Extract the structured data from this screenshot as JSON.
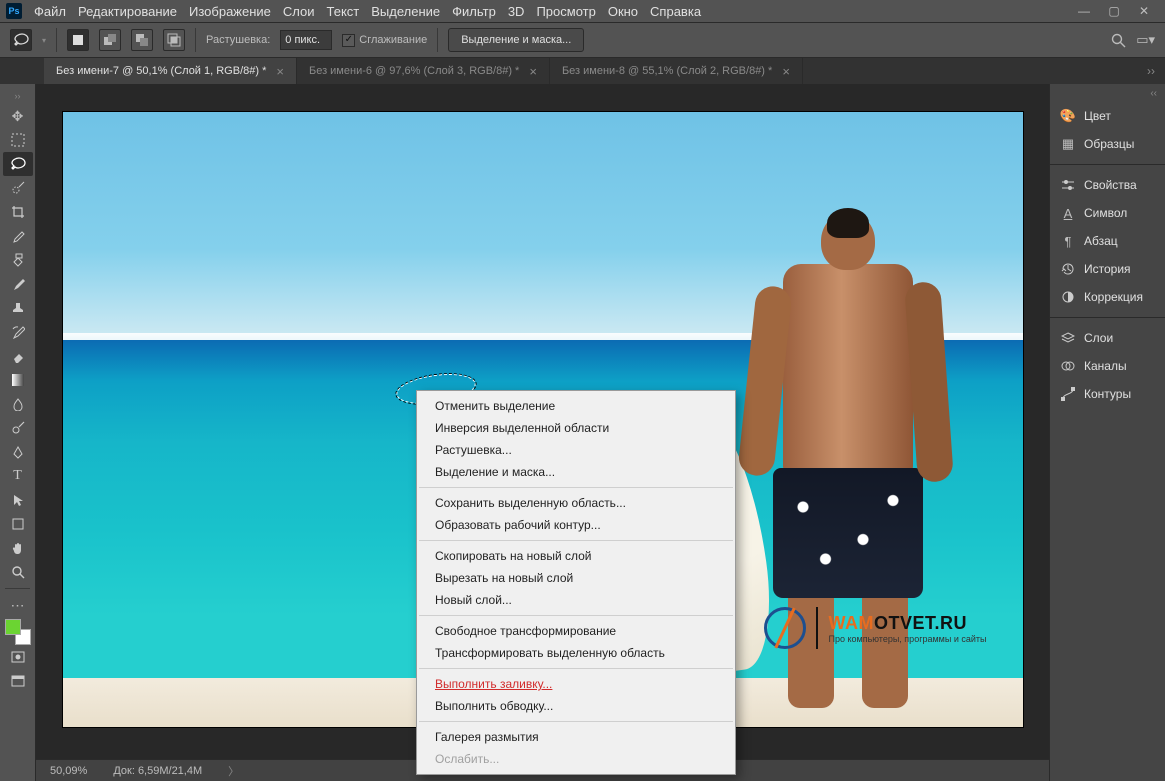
{
  "menubar": {
    "items": [
      "Файл",
      "Редактирование",
      "Изображение",
      "Слои",
      "Текст",
      "Выделение",
      "Фильтр",
      "3D",
      "Просмотр",
      "Окно",
      "Справка"
    ]
  },
  "options": {
    "feather_label": "Растушевка:",
    "feather_value": "0 пикс.",
    "antialias_label": "Сглаживание",
    "select_mask_btn": "Выделение и маска..."
  },
  "tabs": [
    {
      "label": "Без имени-7 @ 50,1% (Слой 1, RGB/8#) *",
      "active": true
    },
    {
      "label": "Без имени-6 @ 97,6% (Слой 3, RGB/8#) *",
      "active": false
    },
    {
      "label": "Без имени-8 @ 55,1% (Слой 2, RGB/8#) *",
      "active": false
    }
  ],
  "panels": {
    "group1": [
      {
        "icon": "palette-icon",
        "label": "Цвет"
      },
      {
        "icon": "swatch-icon",
        "label": "Образцы"
      }
    ],
    "group2": [
      {
        "icon": "sliders-icon",
        "label": "Свойства"
      },
      {
        "icon": "char-icon",
        "label": "Символ"
      },
      {
        "icon": "para-icon",
        "label": "Абзац"
      },
      {
        "icon": "history-icon",
        "label": "История"
      },
      {
        "icon": "adjust-icon",
        "label": "Коррекция"
      }
    ],
    "group3": [
      {
        "icon": "layers-icon",
        "label": "Слои"
      },
      {
        "icon": "channels-icon",
        "label": "Каналы"
      },
      {
        "icon": "paths-icon",
        "label": "Контуры"
      }
    ]
  },
  "context_menu": {
    "groups": [
      [
        "Отменить выделение",
        "Инверсия выделенной области",
        "Растушевка...",
        "Выделение и маска..."
      ],
      [
        "Сохранить выделенную область...",
        "Образовать рабочий контур..."
      ],
      [
        "Скопировать на новый слой",
        "Вырезать на новый слой",
        "Новый слой..."
      ],
      [
        "Свободное трансформирование",
        "Трансформировать выделенную область"
      ]
    ],
    "highlighted": "Выполнить заливку...",
    "after_highlight": [
      "Выполнить обводку..."
    ],
    "last_group": [
      "Галерея размытия"
    ],
    "disabled": [
      "Ослабить..."
    ]
  },
  "status": {
    "zoom": "50,09%",
    "doc_label": "Док:",
    "doc_value": "6,59M/21,4M"
  },
  "watermark": {
    "brand_orange": "WAM",
    "brand_rest": "OTVET.RU",
    "tagline": "Про компьютеры, программы и сайты"
  },
  "swatches": {
    "fg": "#6bd432",
    "bg": "#ffffff"
  }
}
